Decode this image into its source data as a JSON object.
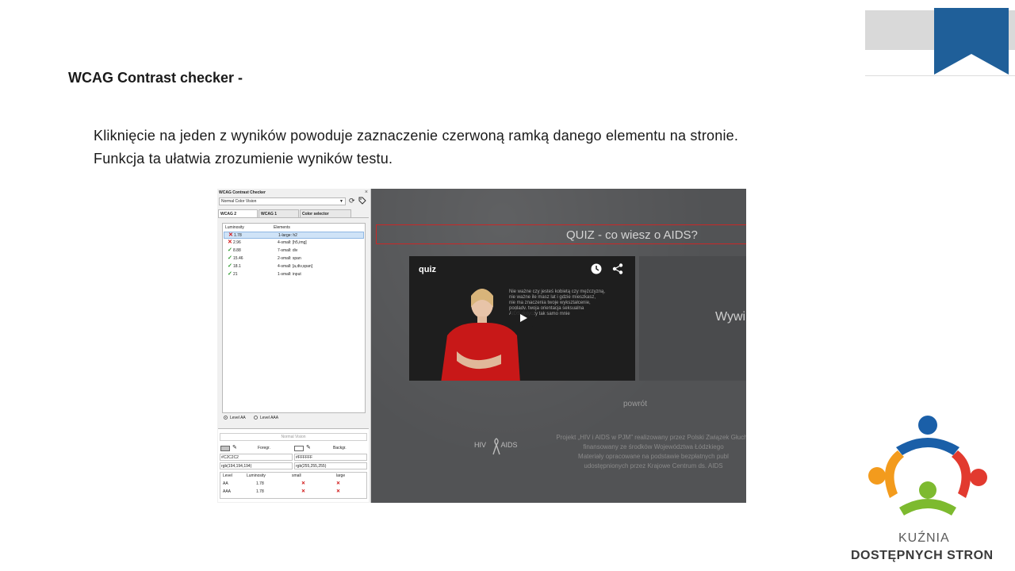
{
  "slide": {
    "title": "WCAG Contrast checker -",
    "body": [
      "Kliknięcie na jeden z wyników powoduje zaznaczenie czerwoną ramką danego elementu na stronie.",
      "Funkcja ta ułatwia zrozumienie wyników testu."
    ]
  },
  "checker": {
    "title": "WCAG Contrast Checker",
    "close": "×",
    "vision_select": "Normal Color Vision",
    "tabs": [
      "WCAG 2",
      "WCAG 1",
      "Color selector"
    ],
    "columns": [
      "Luminosity",
      "Elements"
    ],
    "rows": [
      {
        "status": "fail",
        "mark": "✕",
        "luminosity": "1.78",
        "element": "1-large: h2",
        "selected": true
      },
      {
        "status": "fail",
        "mark": "✕",
        "luminosity": "2.96",
        "element": "4-small: [h5,img]",
        "selected": false
      },
      {
        "status": "pass",
        "mark": "✓",
        "luminosity": "8.88",
        "element": "7-small: div",
        "selected": false
      },
      {
        "status": "pass",
        "mark": "✓",
        "luminosity": "15.46",
        "element": "2-small: span",
        "selected": false
      },
      {
        "status": "pass",
        "mark": "✓",
        "luminosity": "18.1",
        "element": "4-small: [a,div,span]",
        "selected": false
      },
      {
        "status": "pass",
        "mark": "✓",
        "luminosity": "21",
        "element": "1-small: input",
        "selected": false
      }
    ],
    "levels": [
      "Level AA",
      "Level AAA"
    ],
    "selected_level": "Level AA",
    "vision_label": "Normal Vision",
    "foreground_label": "Foregr.",
    "background_label": "Backgr.",
    "foreground_hex": "#C2C2C2",
    "background_hex": "#FFFFFF",
    "foreground_rgb": "rgb(194,194,194)",
    "background_rgb": "rgb(255,255,255)",
    "result_columns": [
      "Level",
      "Luminosity",
      "small",
      "large"
    ],
    "results": [
      {
        "level": "AA",
        "luminosity": "1.78",
        "small": "✕",
        "large": "✕"
      },
      {
        "level": "AAA",
        "luminosity": "1.78",
        "small": "✕",
        "large": "✕"
      }
    ]
  },
  "web": {
    "quiz_heading": "QUIZ - co wiesz o AIDS?",
    "video_label": "quiz",
    "video_text": [
      "Nie ważne czy jesteś kobietą czy mężczyzną,",
      "nie ważne ile masz lat i gdzie mieszkasz,",
      "nie ma znaczenia twoje wykształcenie,",
      "poglądy, twoja orientacja seksualna",
      "AIDS dotyczy tak samo mnie"
    ],
    "panel2_text": "Wywi",
    "back_link": "powrót",
    "hiv_logo_left": "HIV",
    "hiv_logo_right": "AIDS",
    "footer": [
      "Projekt „HIV i AIDS w PJM\" realizowany przez Polski Związek Głuchy",
      "finansowany ze środków Województwa Łódzkiego",
      "Materiały opracowane na podstawie bezpłatnych publ",
      "udostępnionych przez Krajowe Centrum ds. AIDS"
    ]
  },
  "logo": {
    "line1": "KUŹNIA",
    "line2": "DOSTĘPNYCH STRON"
  },
  "colors": {
    "ribbon": "#1f5f99",
    "fail": "#d01010",
    "pass": "#2a9a2a",
    "highlight": "#c82828"
  }
}
